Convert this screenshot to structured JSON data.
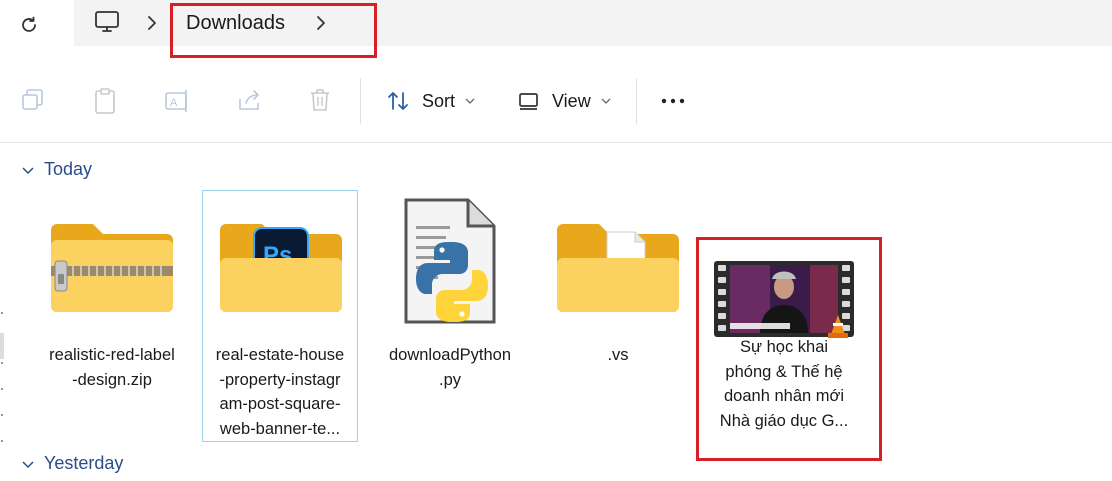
{
  "address_bar": {
    "breadcrumb_current": "Downloads"
  },
  "toolbar": {
    "sort_label": "Sort",
    "view_label": "View"
  },
  "groups": {
    "today": "Today",
    "yesterday": "Yesterday"
  },
  "files": [
    {
      "name": "realistic-red-label-design.zip",
      "display": "realistic-red-label\n-design.zip",
      "icon": "zip-folder-icon"
    },
    {
      "name": "real-estate-house-property-instagram-post-square-web-banner-te...",
      "display": "real-estate-house\n-property-instagr\nam-post-square-\nweb-banner-te...",
      "icon": "photoshop-folder-icon"
    },
    {
      "name": "downloadPython.py",
      "display": "downloadPython\n.py",
      "icon": "python-file-icon"
    },
    {
      "name": ".vs",
      "display": ".vs",
      "icon": "folder-icon"
    },
    {
      "name": "Sự học khai phóng & Thế hệ doanh nhân mới Nhà giáo dục G...",
      "display": "Sự học khai\nphóng & Thế hệ\ndoanh nhân mới\nNhà giáo dục G...",
      "icon": "video-file-icon"
    }
  ],
  "colors": {
    "highlight": "#d61f26",
    "group_header": "#2b4d8a",
    "folder_yellow": "#f9c531",
    "selection_border": "#9bd4e8"
  }
}
